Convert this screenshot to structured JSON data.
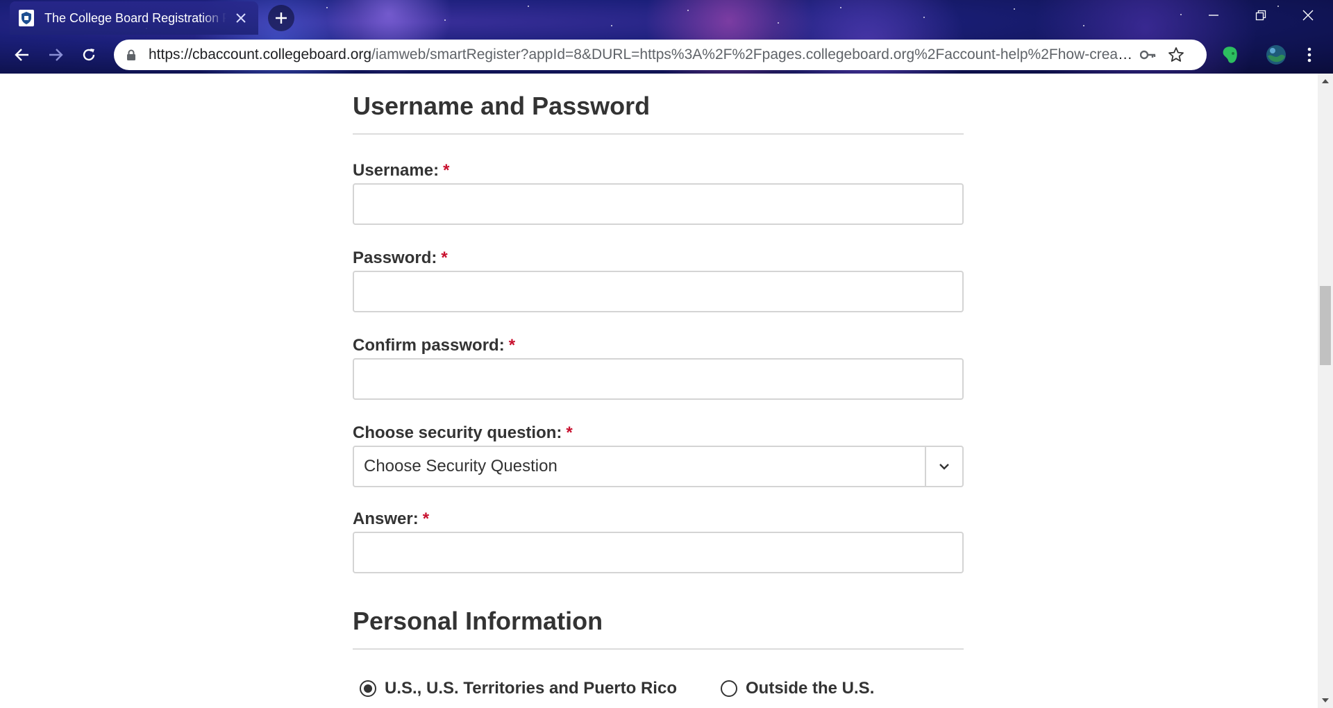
{
  "browser": {
    "tab_title": "The College Board Registration Page",
    "url_host": "https://cbaccount.collegeboard.org",
    "url_rest": "/iamweb/smartRegister?appId=8&DURL=https%3A%2F%2Fpages.collegeboard.org%2Faccount-help%2Fhow-create..."
  },
  "form": {
    "section_username": "Username and Password",
    "username_label": "Username:",
    "password_label": "Password:",
    "confirm_label": "Confirm password:",
    "security_label": "Choose security question:",
    "security_selected": "Choose Security Question",
    "answer_label": "Answer:",
    "required_marker": "*",
    "section_personal": "Personal Information",
    "radio_us": "U.S., U.S. Territories and Puerto Rico",
    "radio_outside": "Outside the U.S."
  },
  "colors": {
    "required": "#c8102e",
    "text": "#333333",
    "border": "#d4d4d4"
  }
}
